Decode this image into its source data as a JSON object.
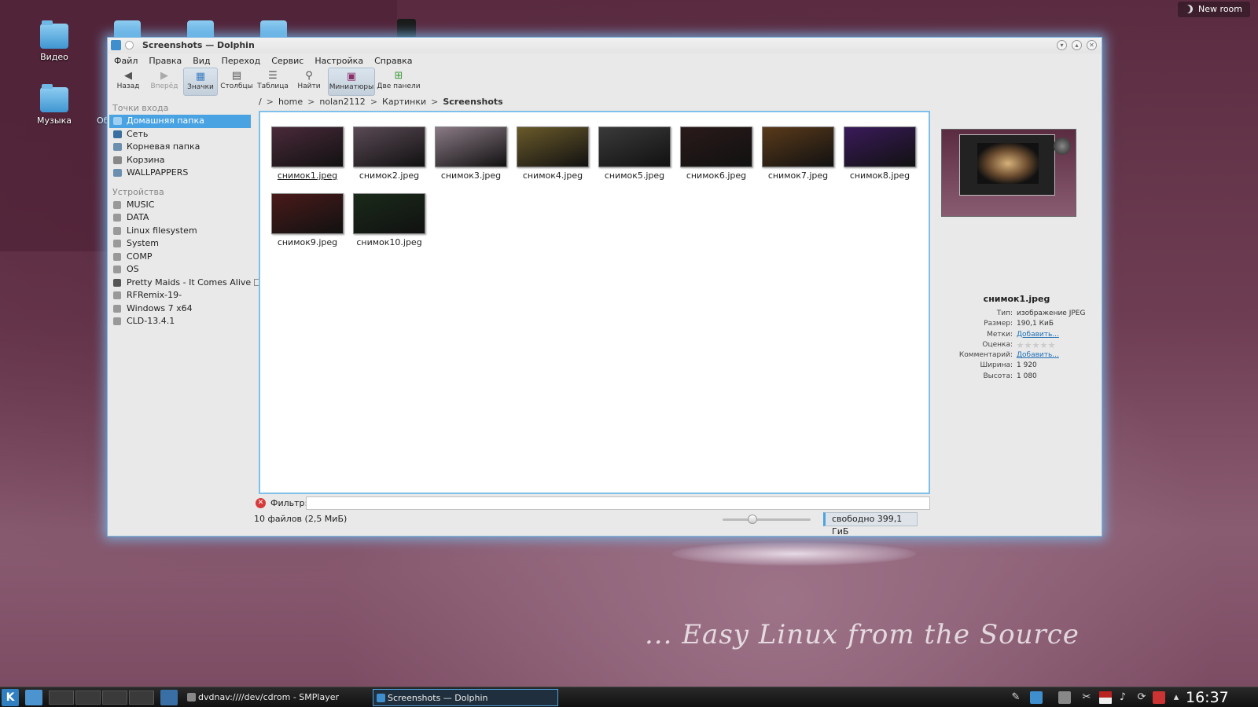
{
  "desktop": {
    "icons": [
      {
        "label": "Видео"
      },
      {
        "label": "Музыка"
      }
    ],
    "partial_label": "Об",
    "new_room": "New room",
    "tagline": "... Easy Linux from the Source"
  },
  "window": {
    "title": "Screenshots — Dolphin",
    "menu": [
      "Файл",
      "Правка",
      "Вид",
      "Переход",
      "Сервис",
      "Настройка",
      "Справка"
    ],
    "toolbar": {
      "back": "Назад",
      "forward": "Вперёд",
      "icons_view": "Значки",
      "columns_view": "Столбцы",
      "details_view": "Таблица",
      "find": "Найти",
      "thumbnails": "Миниатюры",
      "split": "Две панели"
    },
    "places": {
      "header": "Точки входа",
      "items": [
        "Домашняя папка",
        "Сеть",
        "Корневая папка",
        "Корзина",
        "WALLPAPPERS"
      ]
    },
    "devices": {
      "header": "Устройства",
      "items": [
        "MUSIC",
        "DATA",
        "Linux filesystem",
        "System",
        "COMP",
        "OS",
        "Pretty Maids - It Comes Alive",
        "RFRemix-19-",
        "Windows 7 x64",
        "CLD-13.4.1"
      ]
    },
    "breadcrumb": {
      "root": "/",
      "parts": [
        "home",
        "nolan2112",
        "Картинки"
      ],
      "current": "Screenshots"
    },
    "files": [
      {
        "name": "снимок1.jpeg",
        "color": "#4a2a3a"
      },
      {
        "name": "снимок2.jpeg",
        "color": "#5a4a55"
      },
      {
        "name": "снимок3.jpeg",
        "color": "#8a7a85"
      },
      {
        "name": "снимок4.jpeg",
        "color": "#6a5a2a"
      },
      {
        "name": "снимок5.jpeg",
        "color": "#3a3a3a"
      },
      {
        "name": "снимок6.jpeg",
        "color": "#2a1a1a"
      },
      {
        "name": "снимок7.jpeg",
        "color": "#5a3a1a"
      },
      {
        "name": "снимок8.jpeg",
        "color": "#3a1a5a"
      },
      {
        "name": "снимок9.jpeg",
        "color": "#4a1a1a"
      },
      {
        "name": "снимок10.jpeg",
        "color": "#1a2a1a"
      }
    ],
    "filter": {
      "label": "Фильтр:",
      "value": ""
    },
    "status": {
      "count": "10 файлов (2,5 МиБ)",
      "free": "свободно 399,1 ГиБ",
      "zoom_fraction": 0.32
    },
    "info": {
      "name": "снимок1.jpeg",
      "props": [
        {
          "k": "Тип:",
          "v": "изображение JPEG"
        },
        {
          "k": "Размер:",
          "v": "190,1 КиБ"
        },
        {
          "k": "Метки:",
          "v": "Добавить..."
        },
        {
          "k": "Оценка:",
          "v": ""
        },
        {
          "k": "Комментарий:",
          "v": "Добавить..."
        },
        {
          "k": "Ширина:",
          "v": "1 920"
        },
        {
          "k": "Высота:",
          "v": "1 080"
        }
      ]
    }
  },
  "taskbar": {
    "tasks": [
      {
        "label": "dvdnav:////dev/cdrom - SMPlayer"
      },
      {
        "label": "Screenshots — Dolphin"
      }
    ],
    "clock": "16:37"
  }
}
